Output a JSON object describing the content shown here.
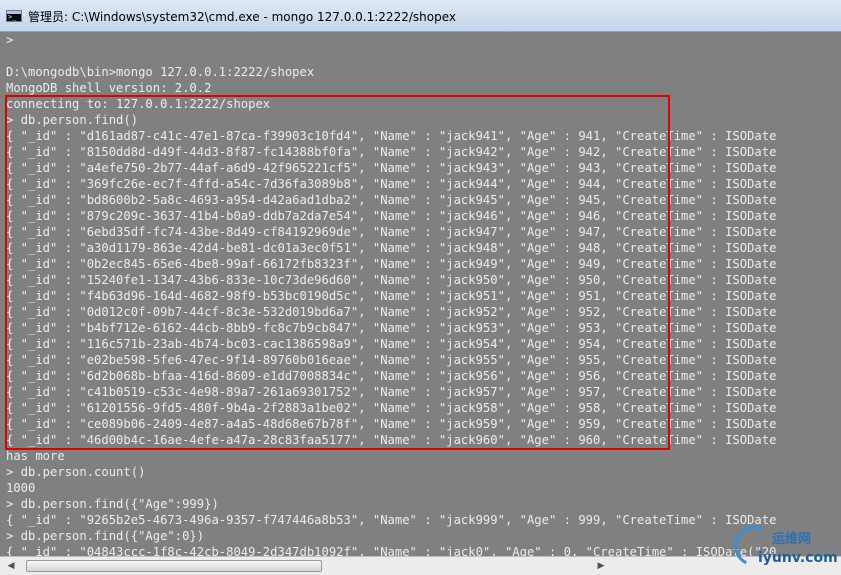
{
  "window": {
    "title": "管理员: C:\\Windows\\system32\\cmd.exe - mongo  127.0.0.1:2222/shopex"
  },
  "console": {
    "lines": [
      ">",
      "",
      "D:\\mongodb\\bin>mongo 127.0.0.1:2222/shopex",
      "MongoDB shell version: 2.0.2",
      "connecting to: 127.0.0.1:2222/shopex",
      "> db.person.find()",
      "{ \"_id\" : \"d161ad87-c41c-47e1-87ca-f39903c10fd4\", \"Name\" : \"jack941\", \"Age\" : 941, \"CreateTime\" : ISODate",
      "{ \"_id\" : \"8150dd8d-d49f-44d3-8f87-fc14388bf0fa\", \"Name\" : \"jack942\", \"Age\" : 942, \"CreateTime\" : ISODate",
      "{ \"_id\" : \"a4efe750-2b77-44af-a6d9-42f965221cf5\", \"Name\" : \"jack943\", \"Age\" : 943, \"CreateTime\" : ISODate",
      "{ \"_id\" : \"369fc26e-ec7f-4ffd-a54c-7d36fa3089b8\", \"Name\" : \"jack944\", \"Age\" : 944, \"CreateTime\" : ISODate",
      "{ \"_id\" : \"bd8600b2-5a8c-4693-a954-d42a6ad1dba2\", \"Name\" : \"jack945\", \"Age\" : 945, \"CreateTime\" : ISODate",
      "{ \"_id\" : \"879c209c-3637-41b4-b0a9-ddb7a2da7e54\", \"Name\" : \"jack946\", \"Age\" : 946, \"CreateTime\" : ISODate",
      "{ \"_id\" : \"6ebd35df-fc74-43be-8d49-cf84192969de\", \"Name\" : \"jack947\", \"Age\" : 947, \"CreateTime\" : ISODate",
      "{ \"_id\" : \"a30d1179-863e-42d4-be81-dc01a3ec0f51\", \"Name\" : \"jack948\", \"Age\" : 948, \"CreateTime\" : ISODate",
      "{ \"_id\" : \"0b2ec845-65e6-4be8-99af-66172fb8323f\", \"Name\" : \"jack949\", \"Age\" : 949, \"CreateTime\" : ISODate",
      "{ \"_id\" : \"15240fe1-1347-43b6-833e-10c73de96d60\", \"Name\" : \"jack950\", \"Age\" : 950, \"CreateTime\" : ISODate",
      "{ \"_id\" : \"f4b63d96-164d-4682-98f9-b53bc0190d5c\", \"Name\" : \"jack951\", \"Age\" : 951, \"CreateTime\" : ISODate",
      "{ \"_id\" : \"0d012c0f-09b7-44cf-8c3e-532d019bd6a7\", \"Name\" : \"jack952\", \"Age\" : 952, \"CreateTime\" : ISODate",
      "{ \"_id\" : \"b4bf712e-6162-44cb-8bb9-fc8c7b9cb847\", \"Name\" : \"jack953\", \"Age\" : 953, \"CreateTime\" : ISODate",
      "{ \"_id\" : \"116c571b-23ab-4b74-bc03-cac1386598a9\", \"Name\" : \"jack954\", \"Age\" : 954, \"CreateTime\" : ISODate",
      "{ \"_id\" : \"e02be598-5fe6-47ec-9f14-89760b016eae\", \"Name\" : \"jack955\", \"Age\" : 955, \"CreateTime\" : ISODate",
      "{ \"_id\" : \"6d2b068b-bfaa-416d-8609-e1dd7008834c\", \"Name\" : \"jack956\", \"Age\" : 956, \"CreateTime\" : ISODate",
      "{ \"_id\" : \"c41b0519-c53c-4e98-89a7-261a69301752\", \"Name\" : \"jack957\", \"Age\" : 957, \"CreateTime\" : ISODate",
      "{ \"_id\" : \"61201556-9fd5-480f-9b4a-2f2883a1be02\", \"Name\" : \"jack958\", \"Age\" : 958, \"CreateTime\" : ISODate",
      "{ \"_id\" : \"ce089b06-2409-4e87-a4a5-48d68e67b78f\", \"Name\" : \"jack959\", \"Age\" : 959, \"CreateTime\" : ISODate",
      "{ \"_id\" : \"46d00b4c-16ae-4efe-a47a-28c83faa5177\", \"Name\" : \"jack960\", \"Age\" : 960, \"CreateTime\" : ISODate",
      "has more",
      "> db.person.count()",
      "1000",
      "> db.person.find({\"Age\":999})",
      "{ \"_id\" : \"9265b2e5-4673-496a-9357-f747446a8b53\", \"Name\" : \"jack999\", \"Age\" : 999, \"CreateTime\" : ISODate",
      "> db.person.find({\"Age\":0})",
      "{ \"_id\" : \"04843ccc-1f8c-42cb-8049-2d347db1092f\", \"Name\" : \"jack0\", \"Age\" : 0, \"CreateTime\" : ISODate(\"20",
      ">"
    ]
  },
  "watermark": {
    "top": "运维网",
    "bottom": "iyunv.com"
  },
  "icons": {
    "window": "cmd-console-icon",
    "scroll_left": "scroll-left-arrow-icon",
    "scroll_right": "scroll-right-arrow-icon"
  },
  "colors": {
    "console_background": "#808080",
    "console_text": "#ececec",
    "highlight_border": "#e00000",
    "titlebar": "#dfe9f5"
  }
}
